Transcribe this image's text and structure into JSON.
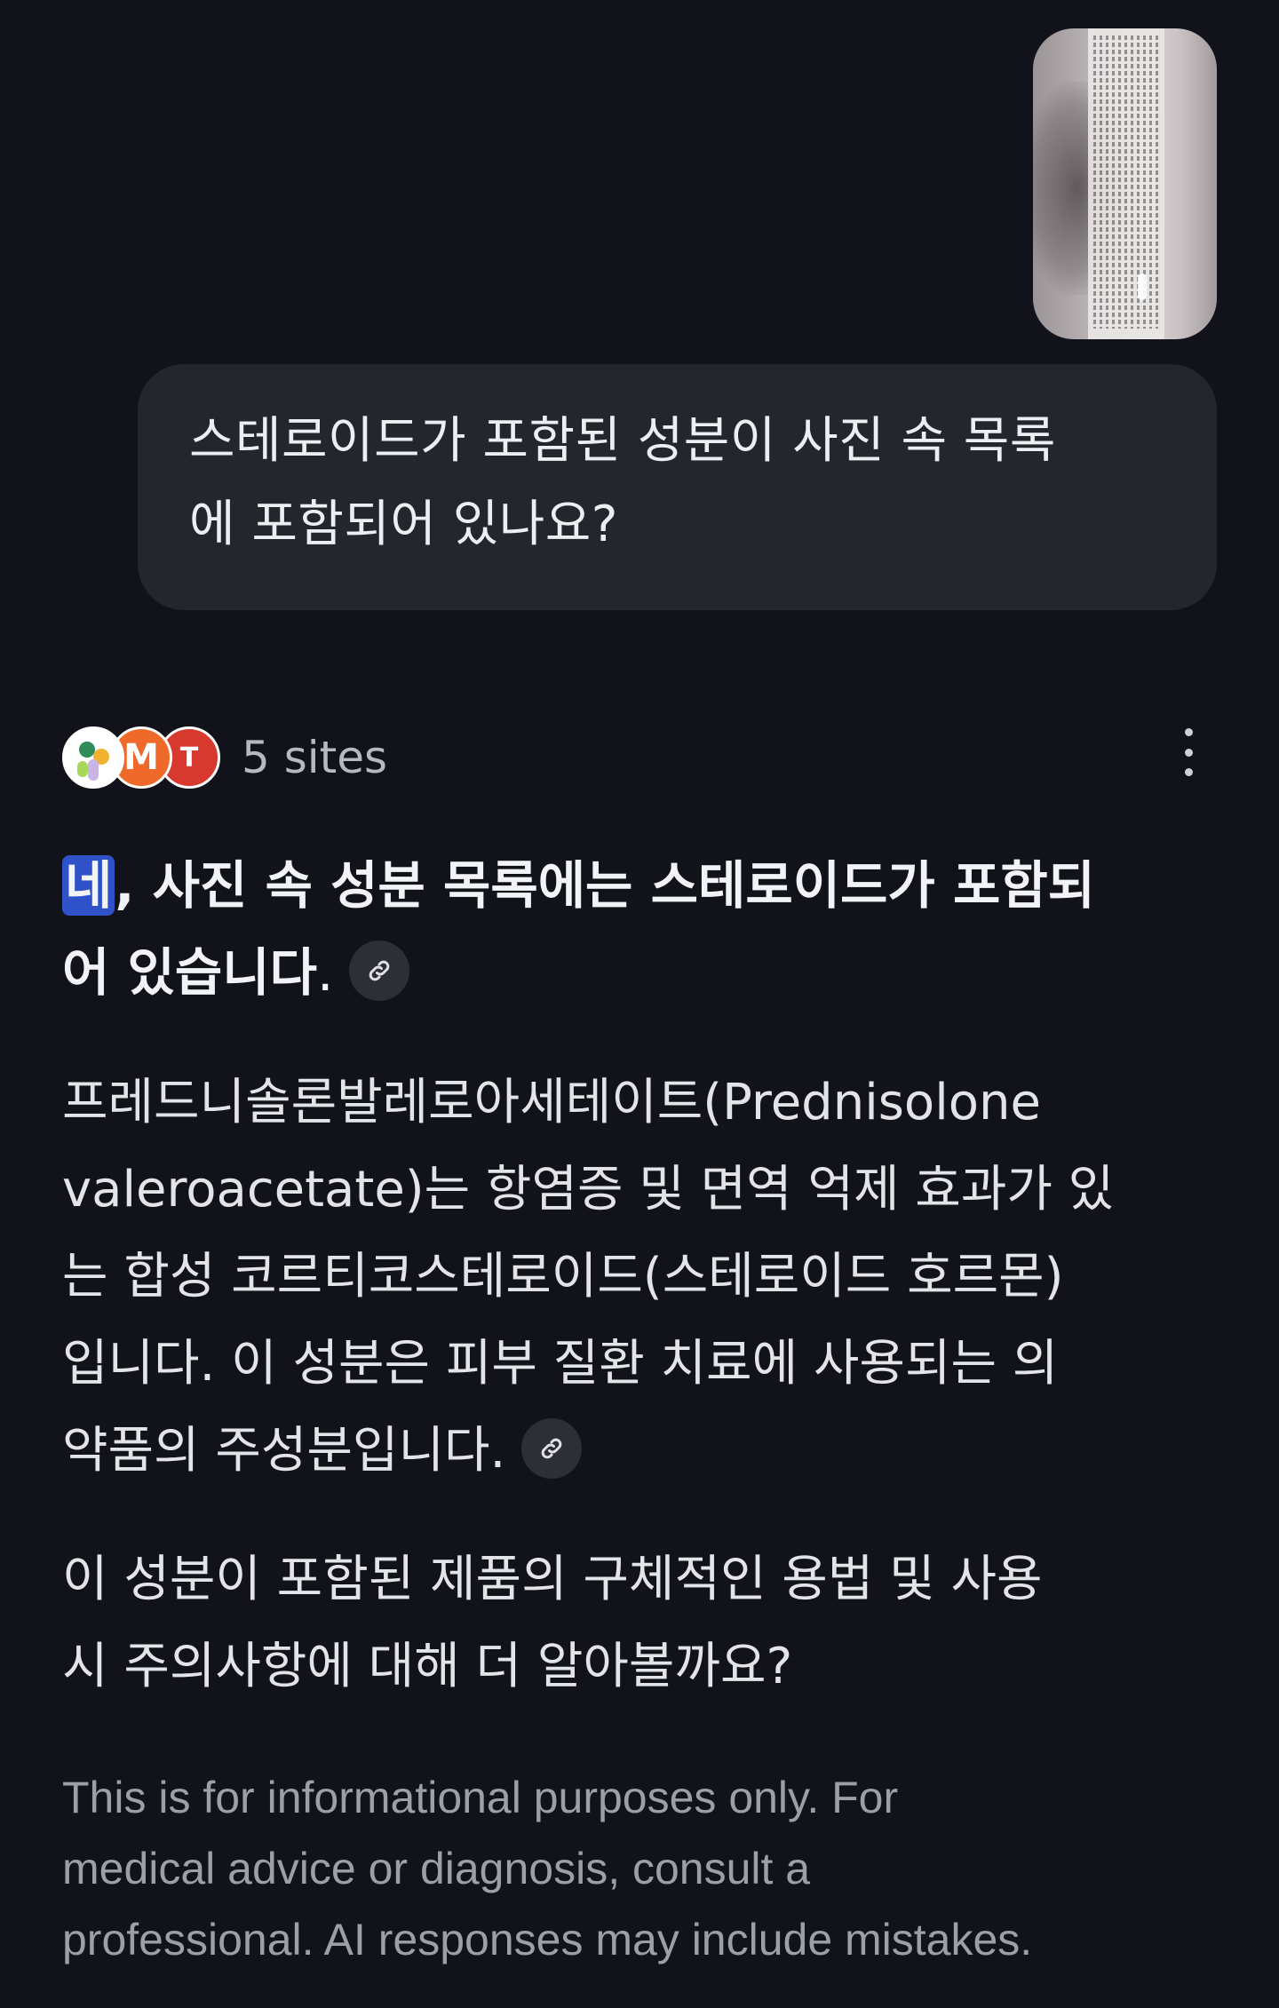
{
  "user_message": {
    "image_alt_icon": "attached-photo",
    "line1": "스테로이드가 포함된 성분이 사진 속 목록",
    "line2": "에 포함되어 있나요?"
  },
  "sources": {
    "label": "5 sites",
    "favicons": [
      {
        "name": "source-favicon-1",
        "letter": ""
      },
      {
        "name": "source-favicon-2",
        "letter": "M"
      },
      {
        "name": "source-favicon-3",
        "letter": "T"
      }
    ],
    "menu_icon": "more-vert-icon"
  },
  "answer": {
    "heading_highlight": "네",
    "heading_rest_line1": ", 사진 속 성분 목록에는 스테로이드가 포함되",
    "heading_line2": "어 있습니다",
    "heading_end": ".",
    "body_lines": [
      "프레드니솔론발레로아세테이트(Prednisolone",
      "valeroacetate)는 항염증 및 면역 억제 효과가 있",
      "는 합성 코르티코스테로이드(스테로이드 호르몬)",
      "입니다. 이 성분은 피부 질환 치료에 사용되는 의",
      "약품의 주성분입니다."
    ],
    "followup_lines": [
      "이 성분이 포함된 제품의 구체적인 용법 및 사용",
      "시 주의사항에 대해 더 알아볼까요?"
    ],
    "disclaimer_lines": [
      "This is for informational purposes only. For",
      "medical advice or diagnosis, consult a",
      "professional. AI responses may include mistakes."
    ],
    "link_icon": "link-icon"
  },
  "colors": {
    "background": "#12131a",
    "bubble": "#24252d",
    "highlight": "#2f52c9"
  }
}
